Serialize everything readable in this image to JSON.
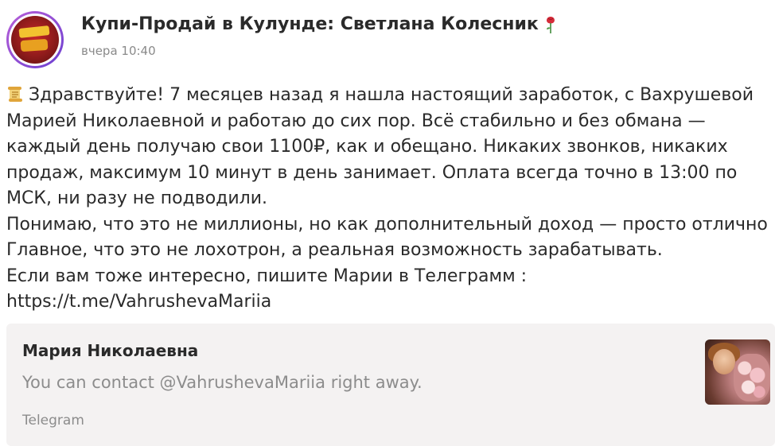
{
  "header": {
    "channel_title": "Купи-Продай в Кулунде: Светлана Колесник",
    "title_emoji": "rose-icon",
    "timestamp": "вчера 10:40"
  },
  "post": {
    "lead_emoji": "scroll-icon",
    "lines": [
      "Здравствуйте! 7 месяцев назад я нашла настоящий заработок, с Вахрушевой",
      "Марией Николаевной и работаю до сих пор. Всё стабильно и без обмана —",
      "каждый день получаю свои 1100₽, как и обещано. Никаких звонков, никаких",
      "продаж, максимум 10 минут в день занимает. Оплата всегда точно в 13:00 по",
      "МСК, ни разу не подводили.",
      "Понимаю, что это не миллионы, но как дополнительный доход — просто отлично",
      "Главное, что это не лохотрон, а реальная возможность зарабатывать.",
      "Если вам тоже интересно, пишите Марии в Телеграмм :",
      "https://t.me/VahrushevaMariia"
    ]
  },
  "link_preview": {
    "title": "Мария Николаевна",
    "description": "You can contact @VahrushevaMariia right away.",
    "source": "Telegram"
  },
  "colors": {
    "avatar_ring": "#8b4fd6",
    "card_background": "#f4f2f2",
    "muted_text": "#8c8c8c"
  }
}
